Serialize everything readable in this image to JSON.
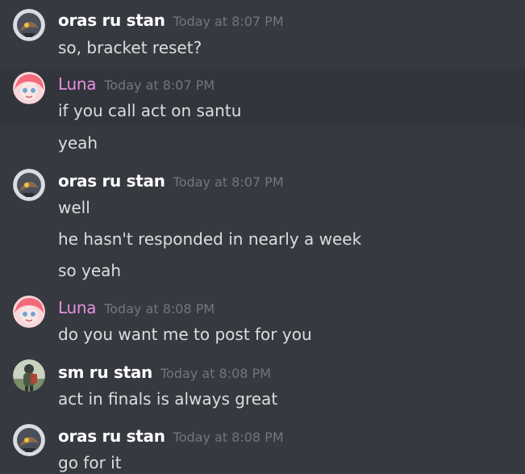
{
  "messages": [
    {
      "author": "oras ru stan",
      "time": "Today at 8:07 PM",
      "lines": [
        "so, bracket reset?"
      ]
    },
    {
      "author": "Luna",
      "time": "Today at 8:07 PM",
      "lines": [
        "if you call act on santu",
        "yeah"
      ]
    },
    {
      "author": "oras ru stan",
      "time": "Today at 8:07 PM",
      "lines": [
        "well",
        "he hasn't responded in nearly a week",
        "so yeah"
      ]
    },
    {
      "author": "Luna",
      "time": "Today at 8:08 PM",
      "lines": [
        "do you want me to post for you"
      ]
    },
    {
      "author": "sm ru stan",
      "time": "Today at 8:08 PM",
      "lines": [
        "act in finals is always great"
      ]
    },
    {
      "author": "oras ru stan",
      "time": "Today at 8:08 PM",
      "lines": [
        "go for it"
      ]
    }
  ],
  "avatars": {
    "oras": "gray-circle-avatar",
    "luna": "pink-haired-character-avatar",
    "sm": "figure-with-backpack-avatar"
  },
  "colors": {
    "background": "#36393f",
    "highlight": "#32353b",
    "username": "#ffffff",
    "luna_username": "#e491e3",
    "timestamp": "#72767d",
    "message_text": "#dcddde"
  }
}
